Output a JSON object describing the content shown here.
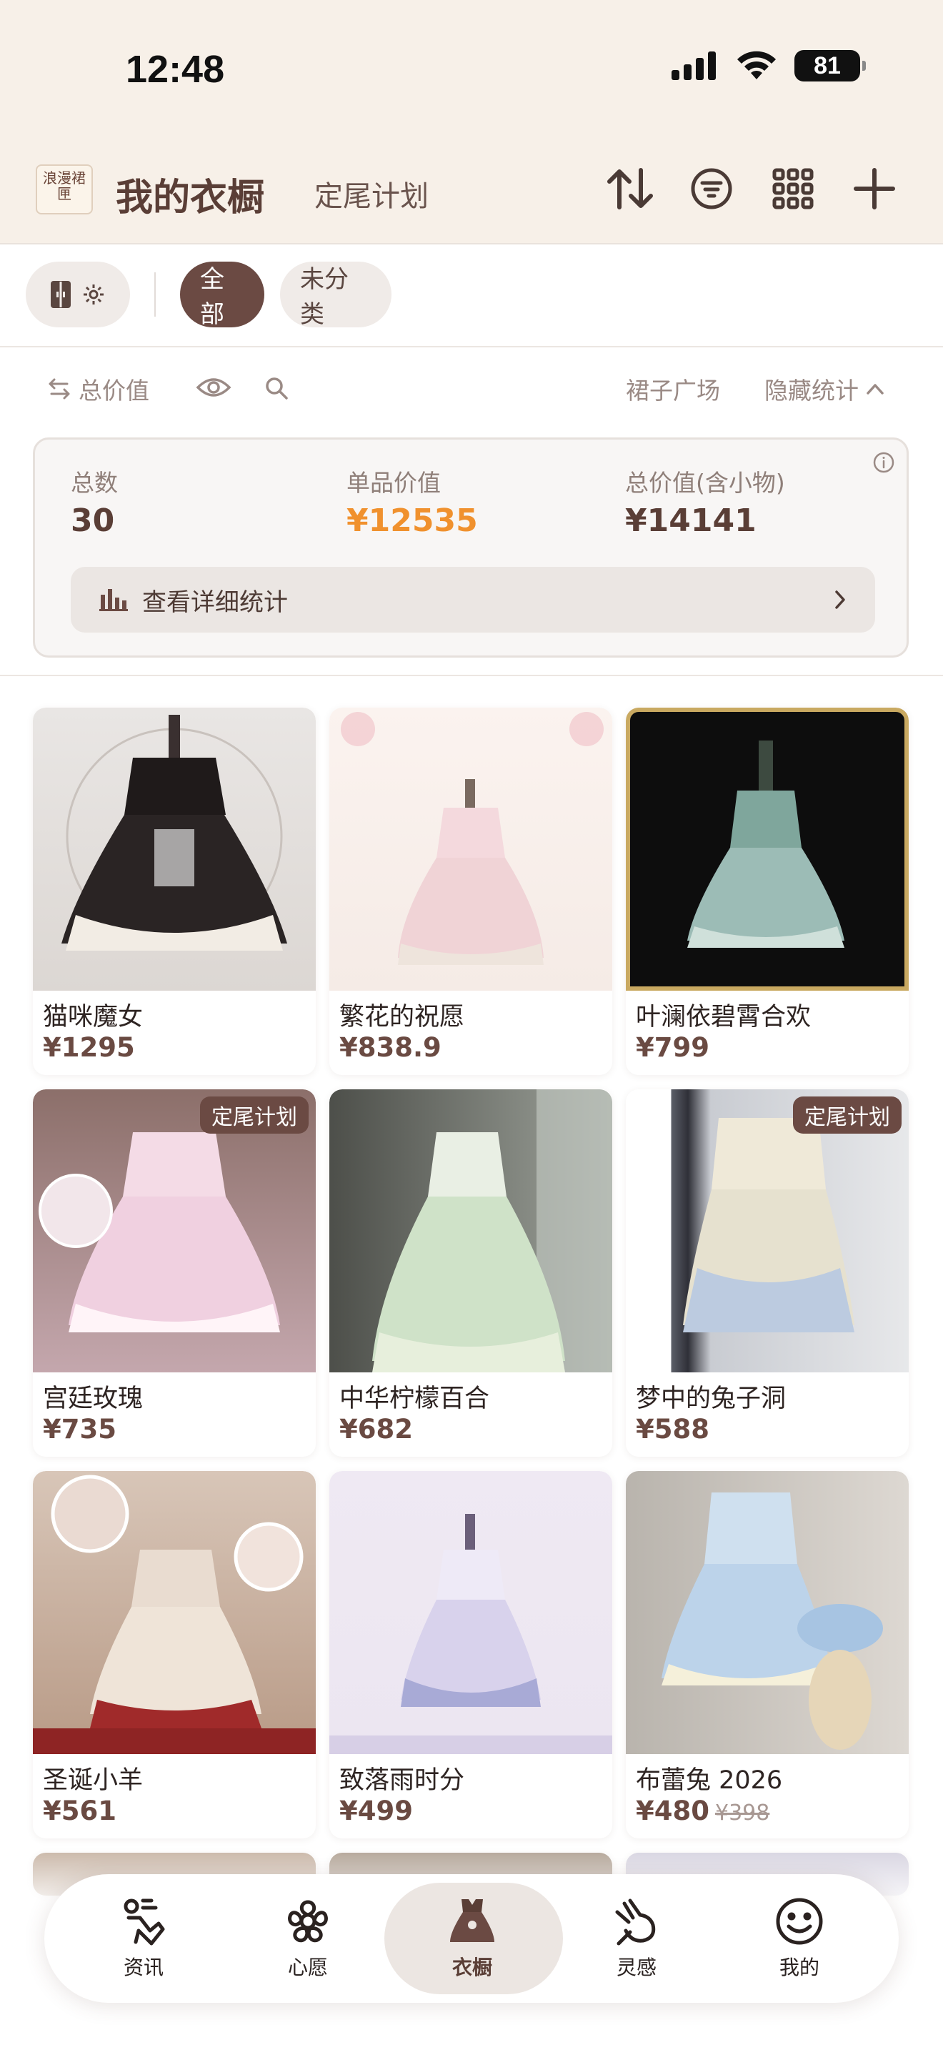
{
  "status": {
    "time": "12:48",
    "battery": "81"
  },
  "header": {
    "logo_text": "浪漫裙匣",
    "title": "我的衣橱",
    "subtitle": "定尾计划",
    "actions": [
      "sort-icon",
      "filter-icon",
      "grid-icon",
      "add-icon"
    ]
  },
  "filters": {
    "chips": [
      {
        "label": "全部",
        "active": true
      },
      {
        "label": "未分类",
        "active": false
      }
    ]
  },
  "toolbar": {
    "total_value_toggle": "总价值",
    "skirt_plaza": "裙子广场",
    "hide_stats": "隐藏统计"
  },
  "stats": {
    "count_label": "总数",
    "count_value": "30",
    "item_value_label": "单品价值",
    "item_value": "¥12535",
    "total_value_label": "总价值(含小物)",
    "total_value": "¥14141",
    "detail_button": "查看详细统计"
  },
  "items": [
    {
      "name": "猫咪魔女",
      "price": "¥1295",
      "badge": ""
    },
    {
      "name": "繁花的祝愿",
      "price": "¥838.9",
      "badge": ""
    },
    {
      "name": "叶澜依碧霄合欢",
      "price": "¥799",
      "badge": ""
    },
    {
      "name": "宫廷玫瑰",
      "price": "¥735",
      "badge": "定尾计划"
    },
    {
      "name": "中华柠檬百合",
      "price": "¥682",
      "badge": ""
    },
    {
      "name": "梦中的兔子洞",
      "price": "¥588",
      "badge": "定尾计划"
    },
    {
      "name": "圣诞小羊",
      "price": "¥561",
      "badge": ""
    },
    {
      "name": "致落雨时分",
      "price": "¥499",
      "badge": ""
    },
    {
      "name": "布蕾兔 2026",
      "price": "¥480",
      "old_price": "¥398",
      "badge": ""
    }
  ],
  "tabbar": [
    {
      "label": "资讯",
      "icon": "news-icon",
      "active": false
    },
    {
      "label": "心愿",
      "icon": "flower-icon",
      "active": false
    },
    {
      "label": "衣橱",
      "icon": "wardrobe-icon",
      "active": true
    },
    {
      "label": "灵感",
      "icon": "inspiration-icon",
      "active": false
    },
    {
      "label": "我的",
      "icon": "smile-icon",
      "active": false
    }
  ],
  "colors": {
    "brand": "#6b4a43",
    "accent": "#f0912e",
    "header_bg": "#f7f0e8"
  }
}
